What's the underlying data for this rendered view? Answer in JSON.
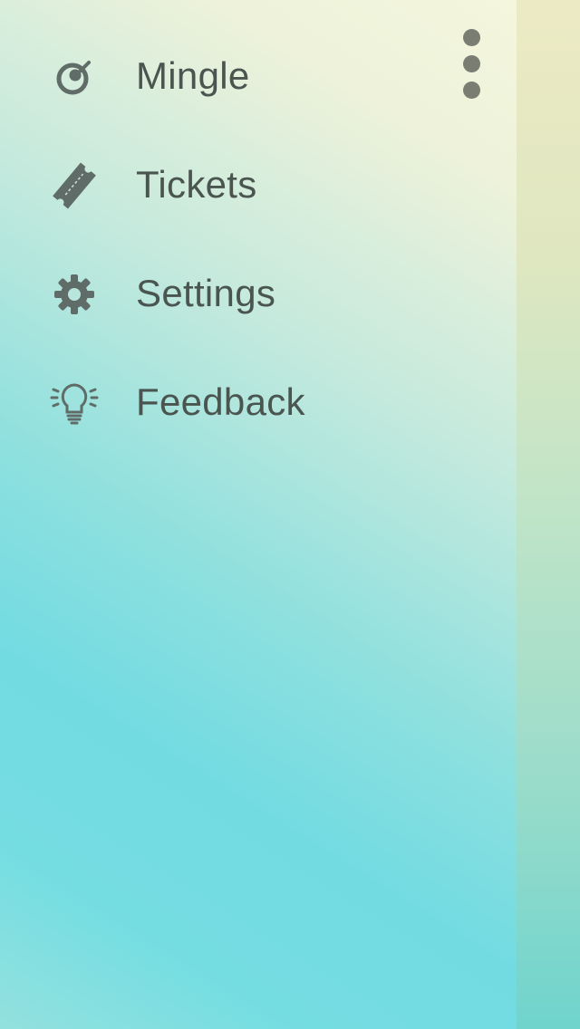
{
  "colors": {
    "icon": "#5f6c67",
    "label": "#4a5550",
    "overflow_dots": "#7a7d72",
    "gradient_top_right": "#f4f6dd",
    "gradient_bottom_left": "#72dbe2"
  },
  "overflow_menu": {
    "icon": "vertical-ellipsis-icon"
  },
  "menu": {
    "items": [
      {
        "label": "Mingle",
        "icon": "eye-radar-icon"
      },
      {
        "label": "Tickets",
        "icon": "ticket-icon"
      },
      {
        "label": "Settings",
        "icon": "gear-icon"
      },
      {
        "label": "Feedback",
        "icon": "lightbulb-icon"
      }
    ]
  }
}
